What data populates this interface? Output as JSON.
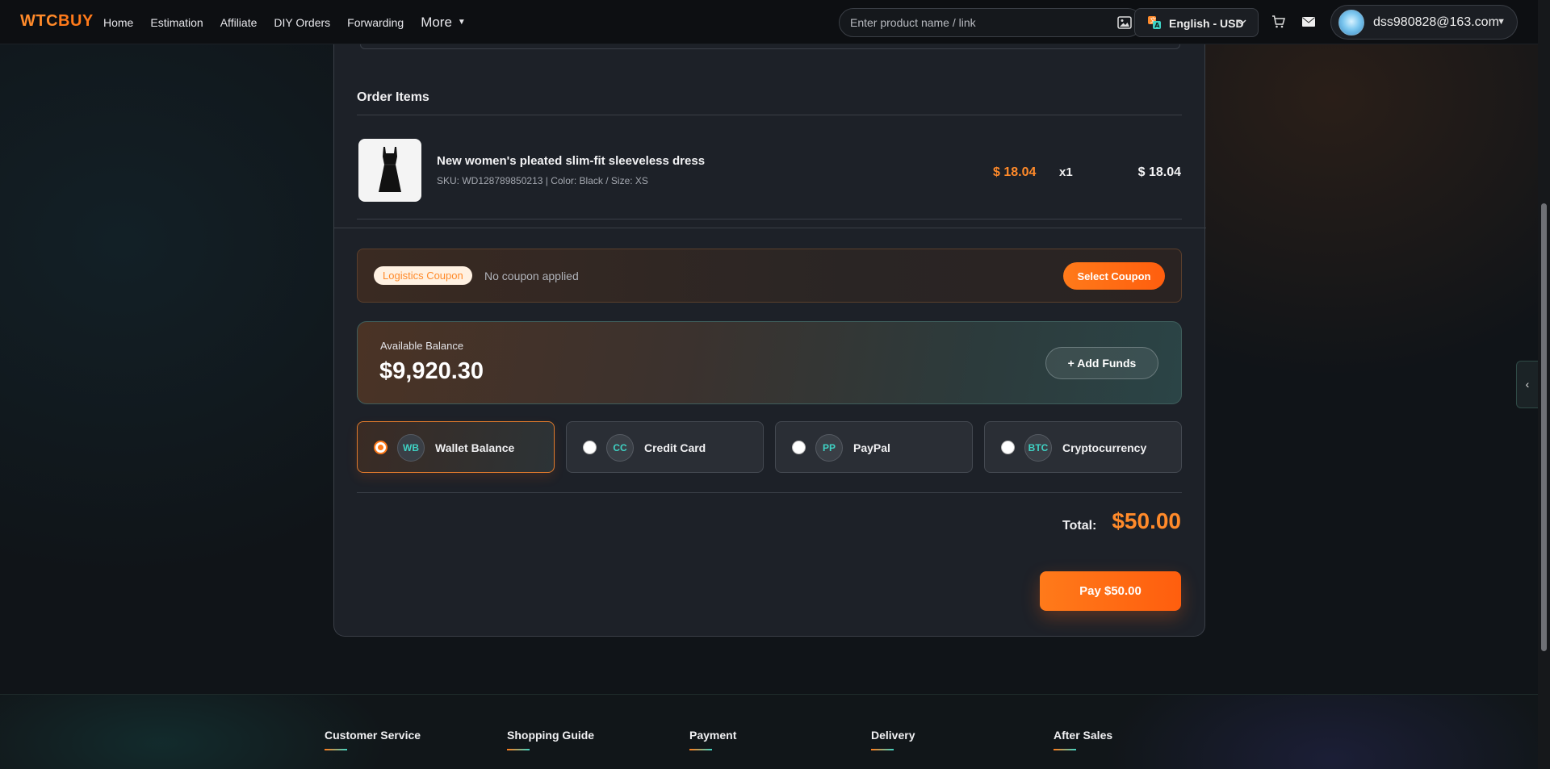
{
  "header": {
    "logo": "WTCBUY",
    "nav": [
      "Home",
      "Estimation",
      "Affiliate",
      "DIY Orders",
      "Forwarding"
    ],
    "more_label": "More",
    "search_placeholder": "Enter product name / link",
    "language_label": "English - USD",
    "user_email": "dss980828@163.com"
  },
  "order": {
    "section_title": "Order Items",
    "item": {
      "name": "New women's pleated slim-fit sleeveless dress",
      "meta": "SKU: WD128789850213 | Color: Black / Size: XS",
      "price": "$ 18.04",
      "qty": "x1",
      "total": "$ 18.04"
    }
  },
  "coupon": {
    "tag": "Logistics Coupon",
    "status": "No coupon applied",
    "button": "Select Coupon"
  },
  "balance": {
    "label": "Available Balance",
    "amount": "$9,920.30",
    "button": "+ Add Funds"
  },
  "payment_methods": [
    {
      "badge": "WB",
      "name": "Wallet Balance",
      "selected": true
    },
    {
      "badge": "CC",
      "name": "Credit Card",
      "selected": false
    },
    {
      "badge": "PP",
      "name": "PayPal",
      "selected": false
    },
    {
      "badge": "BTC",
      "name": "Cryptocurrency",
      "selected": false
    }
  ],
  "summary": {
    "total_label": "Total:",
    "total_value": "$50.00",
    "pay_button": "Pay $50.00"
  },
  "footer": {
    "columns": [
      "Customer Service",
      "Shopping Guide",
      "Payment",
      "Delivery",
      "After Sales"
    ]
  },
  "colors": {
    "accent": "#ff7a1a",
    "teal": "#3fd2c4",
    "card_bg": "#1d2128"
  },
  "icons": [
    "image-search-icon",
    "translate-icon",
    "chevron-down-icon",
    "cart-icon",
    "mail-icon",
    "chevron-left-icon"
  ]
}
